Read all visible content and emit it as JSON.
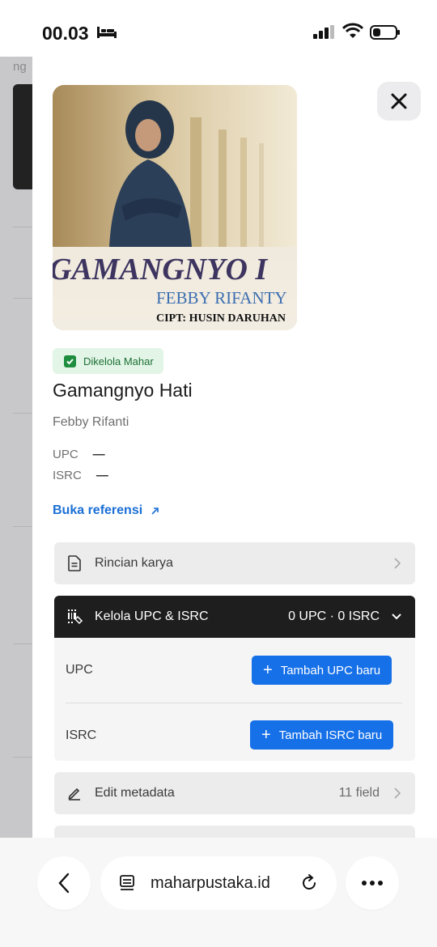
{
  "status_bar": {
    "time": "00.03",
    "icons": [
      "bed-icon",
      "signal-icon",
      "wifi-icon",
      "battery-icon"
    ]
  },
  "background_page": {
    "partial_text": "ng"
  },
  "sheet": {
    "close_icon": "close-icon",
    "cover": {
      "title_overlay": "GAMANGNYO I",
      "artist_overlay": "FEBBY RIFANTY",
      "composer_overlay": "CIPT: HUSIN DARUHAN"
    },
    "badge_label": "Dikelola Mahar",
    "song_title": "Gamangnyo Hati",
    "artist": "Febby Rifanti",
    "codes": [
      {
        "label": "UPC",
        "value": "—"
      },
      {
        "label": "ISRC",
        "value": "—"
      }
    ],
    "reference_link": "Buka referensi",
    "details_row": {
      "label": "Rincian karya",
      "icon": "document-icon"
    },
    "manage_section": {
      "label": "Kelola UPC & ISRC",
      "icon": "barcode-icon",
      "count": "0 UPC · 0 ISRC",
      "upc_label": "UPC",
      "upc_button": "Tambah UPC baru",
      "isrc_label": "ISRC",
      "isrc_button": "Tambah ISRC baru"
    },
    "metadata_row": {
      "label": "Edit metadata",
      "meta": "11 field",
      "icon": "pencil-icon"
    }
  },
  "browser": {
    "back_icon": "chevron-left-icon",
    "url": "maharpustaka.id",
    "reader_icon": "reader-icon",
    "reload_icon": "reload-icon",
    "more_icon": "more-icon"
  },
  "colors": {
    "accent_blue": "#1670e8",
    "badge_green": "#1e8e3e",
    "dark_header": "#1e1e1e"
  }
}
